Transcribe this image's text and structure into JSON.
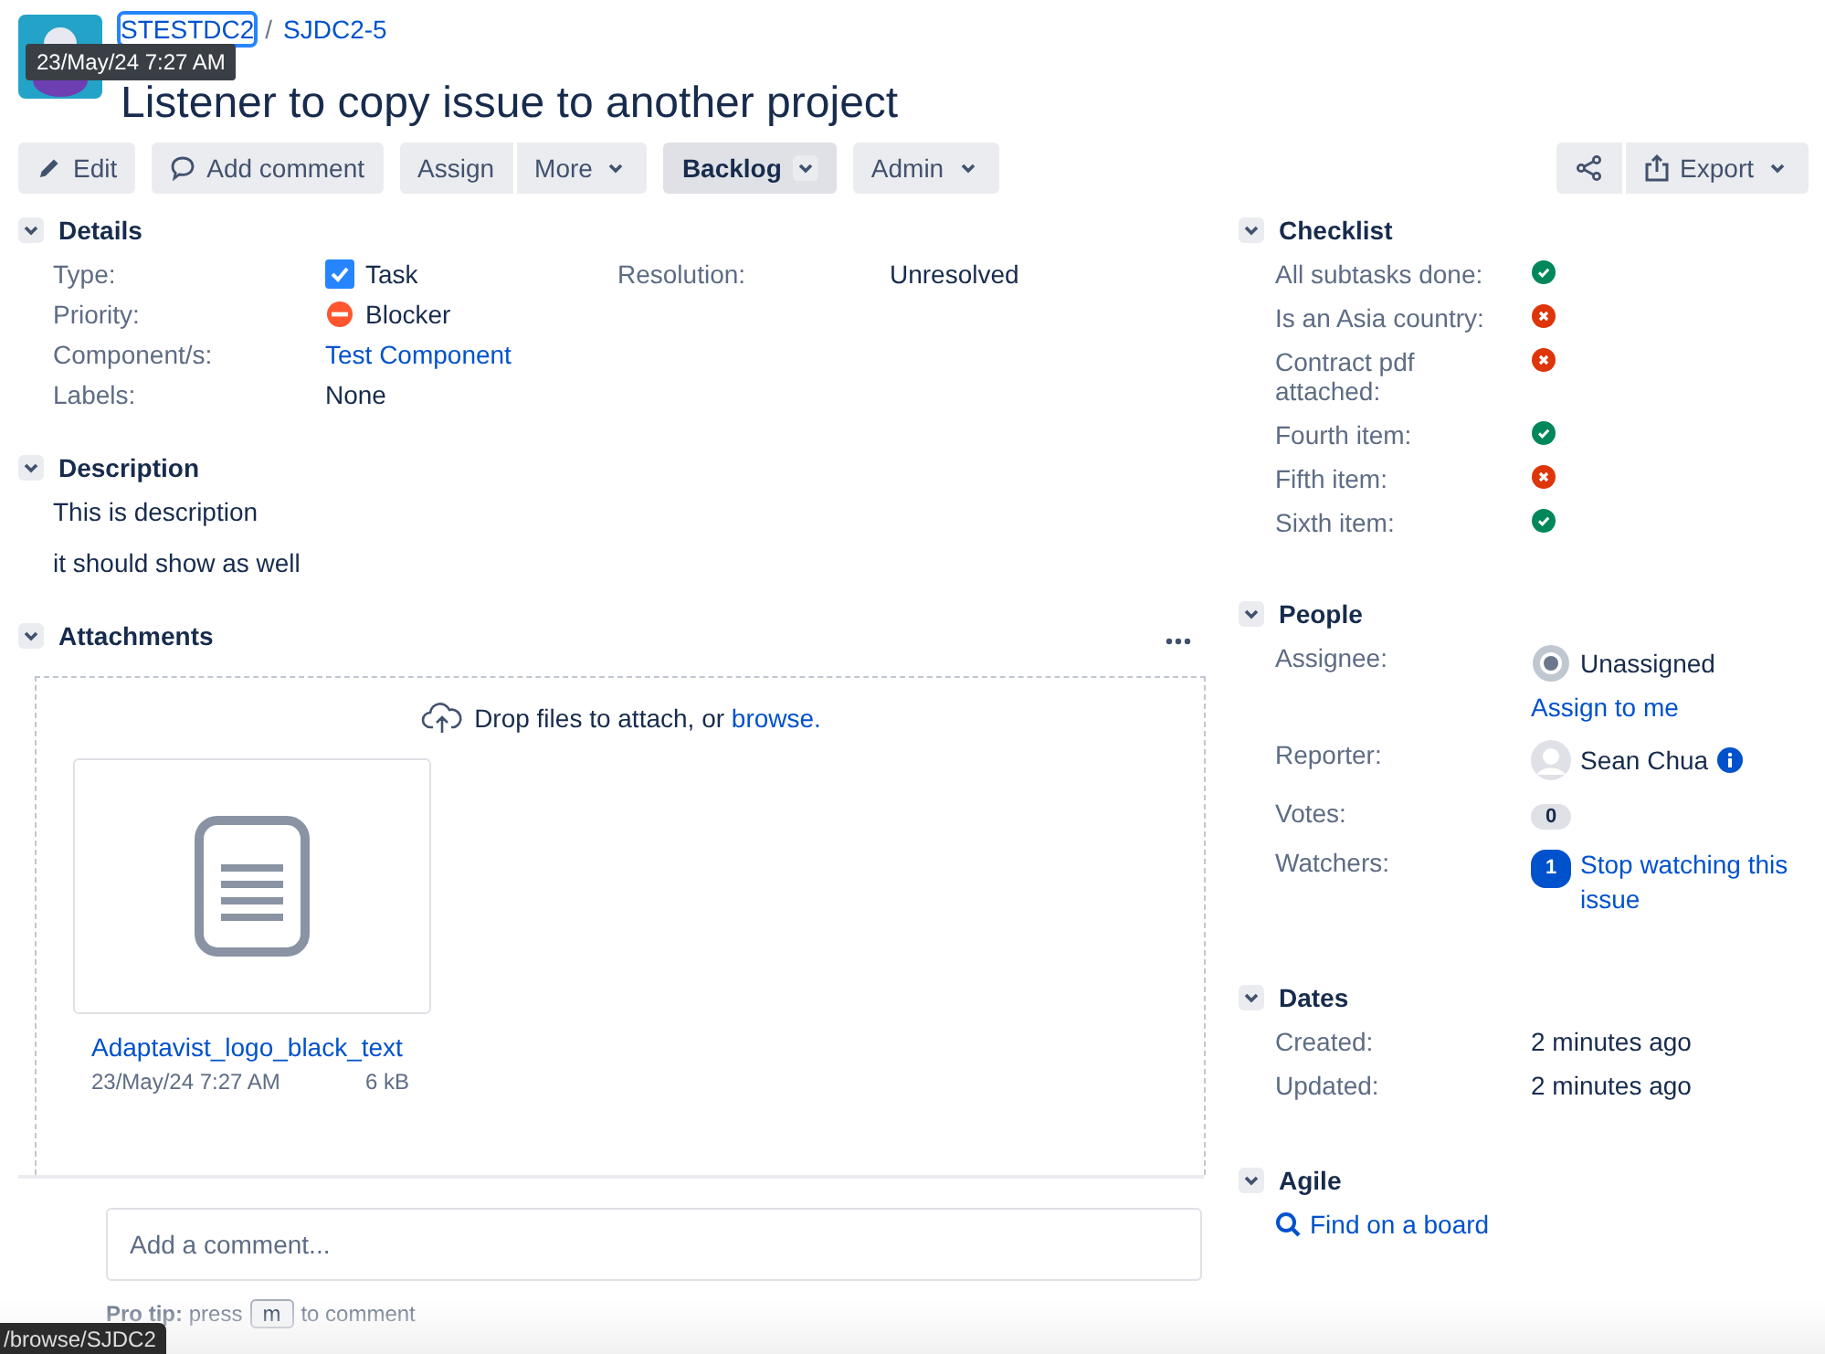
{
  "tooltip": "23/May/24 7:27 AM",
  "breadcrumbs": [
    {
      "label": "STESTDC2",
      "focused": true
    },
    {
      "label": "SJDC2-5",
      "focused": false
    }
  ],
  "breadcrumb_separator": "/",
  "title": "Listener to copy issue to another project",
  "toolbar": [
    {
      "label": "Edit",
      "dropdown": false,
      "kind": "button"
    },
    {
      "label": "Add comment",
      "dropdown": false,
      "kind": "button"
    },
    {
      "label": "Assign",
      "dropdown": false,
      "kind": "group-start"
    },
    {
      "label": "More",
      "dropdown": true,
      "kind": "group-end"
    },
    {
      "label": "Backlog",
      "dropdown": true,
      "kind": "status"
    },
    {
      "label": "Admin",
      "dropdown": true,
      "kind": "button"
    }
  ],
  "toolbar_right": [
    {
      "kind": "group-start"
    },
    {
      "label": "Export",
      "dropdown": true,
      "kind": "group-end"
    }
  ],
  "details": {
    "heading": "Details",
    "fields": [
      {
        "label": "Type:",
        "value": "Task",
        "kind": "issue-type"
      },
      {
        "label": "Priority:",
        "value": "Blocker",
        "kind": "priority"
      },
      {
        "label": "Component/s:",
        "value": "Test Component",
        "kind": "link"
      },
      {
        "label": "Labels:",
        "value": "None",
        "kind": "text"
      }
    ],
    "side_fields": [
      {
        "label": "Resolution:",
        "value": "Unresolved"
      }
    ]
  },
  "description": {
    "heading": "Description",
    "paragraphs": [
      "This is description",
      "it should show as well"
    ]
  },
  "attachments": {
    "heading": "Attachments",
    "drop_text": "Drop files to attach, or ",
    "drop_link": "browse.",
    "files": [
      {
        "name": "Adaptavist_logo_black_text",
        "date": "23/May/24 7:27 AM",
        "size": "6 kB"
      }
    ]
  },
  "comment": {
    "placeholder": "Add a comment...",
    "tip_label": "Pro tip:",
    "tip_before": "press",
    "tip_key": "m",
    "tip_after": "to comment"
  },
  "checklist": {
    "heading": "Checklist",
    "items": [
      {
        "label": "All subtasks done:",
        "done": true
      },
      {
        "label": "Is an Asia country:",
        "done": false
      },
      {
        "label": "Contract pdf attached:",
        "done": false
      },
      {
        "label": "Fourth item:",
        "done": true
      },
      {
        "label": "Fifth item:",
        "done": false
      },
      {
        "label": "Sixth item:",
        "done": true
      }
    ]
  },
  "people": {
    "heading": "People",
    "assignee_label": "Assignee:",
    "assignee": "Unassigned",
    "assign_link": "Assign to me",
    "reporter_label": "Reporter:",
    "reporter": "Sean Chua",
    "votes_label": "Votes:",
    "votes": "0",
    "watchers_label": "Watchers:",
    "watchers": "1",
    "watch_link": "Stop watching this issue"
  },
  "dates": {
    "heading": "Dates",
    "fields": [
      {
        "label": "Created:",
        "value": "2 minutes ago"
      },
      {
        "label": "Updated:",
        "value": "2 minutes ago"
      }
    ]
  },
  "agile": {
    "heading": "Agile",
    "link": "Find on a board"
  },
  "status_url": "/browse/SJDC2"
}
